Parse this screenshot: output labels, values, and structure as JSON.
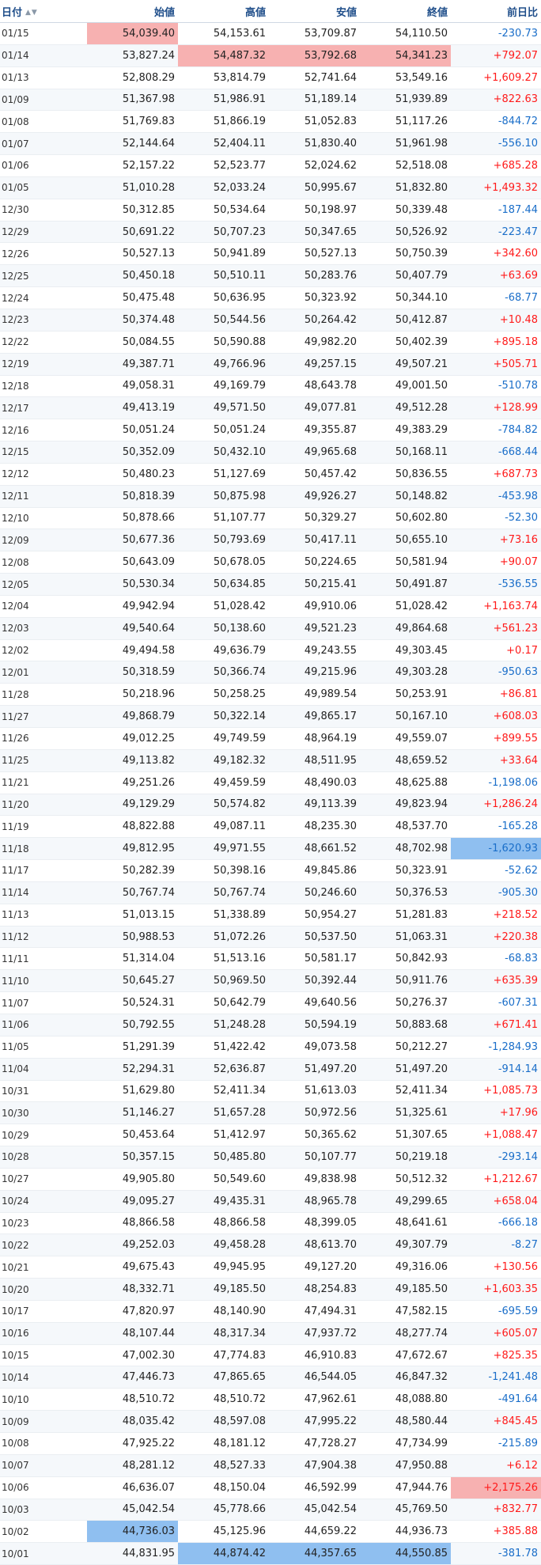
{
  "table": {
    "headers": {
      "date": "日付",
      "open": "始値",
      "high": "高値",
      "low": "安値",
      "close": "終値",
      "change": "前日比"
    },
    "sort_icon": "sort-arrows-icon",
    "colors": {
      "positive": "#ff1a1a",
      "negative": "#1a6ec9",
      "highlight_red": "#f7b1b1",
      "highlight_blue": "#8fbff0"
    },
    "rows": [
      {
        "date": "01/15",
        "open": "54,039.40",
        "high": "54,153.61",
        "low": "53,709.87",
        "close": "54,110.50",
        "change": "-230.73",
        "hl": {
          "open": "red"
        }
      },
      {
        "date": "01/14",
        "open": "53,827.24",
        "high": "54,487.32",
        "low": "53,792.68",
        "close": "54,341.23",
        "change": "+792.07",
        "hl": {
          "high": "red",
          "low": "red",
          "close": "red"
        }
      },
      {
        "date": "01/13",
        "open": "52,808.29",
        "high": "53,814.79",
        "low": "52,741.64",
        "close": "53,549.16",
        "change": "+1,609.27"
      },
      {
        "date": "01/09",
        "open": "51,367.98",
        "high": "51,986.91",
        "low": "51,189.14",
        "close": "51,939.89",
        "change": "+822.63"
      },
      {
        "date": "01/08",
        "open": "51,769.83",
        "high": "51,866.19",
        "low": "51,052.83",
        "close": "51,117.26",
        "change": "-844.72"
      },
      {
        "date": "01/07",
        "open": "52,144.64",
        "high": "52,404.11",
        "low": "51,830.40",
        "close": "51,961.98",
        "change": "-556.10"
      },
      {
        "date": "01/06",
        "open": "52,157.22",
        "high": "52,523.77",
        "low": "52,024.62",
        "close": "52,518.08",
        "change": "+685.28"
      },
      {
        "date": "01/05",
        "open": "51,010.28",
        "high": "52,033.24",
        "low": "50,995.67",
        "close": "51,832.80",
        "change": "+1,493.32"
      },
      {
        "date": "12/30",
        "open": "50,312.85",
        "high": "50,534.64",
        "low": "50,198.97",
        "close": "50,339.48",
        "change": "-187.44"
      },
      {
        "date": "12/29",
        "open": "50,691.22",
        "high": "50,707.23",
        "low": "50,347.65",
        "close": "50,526.92",
        "change": "-223.47"
      },
      {
        "date": "12/26",
        "open": "50,527.13",
        "high": "50,941.89",
        "low": "50,527.13",
        "close": "50,750.39",
        "change": "+342.60"
      },
      {
        "date": "12/25",
        "open": "50,450.18",
        "high": "50,510.11",
        "low": "50,283.76",
        "close": "50,407.79",
        "change": "+63.69"
      },
      {
        "date": "12/24",
        "open": "50,475.48",
        "high": "50,636.95",
        "low": "50,323.92",
        "close": "50,344.10",
        "change": "-68.77"
      },
      {
        "date": "12/23",
        "open": "50,374.48",
        "high": "50,544.56",
        "low": "50,264.42",
        "close": "50,412.87",
        "change": "+10.48"
      },
      {
        "date": "12/22",
        "open": "50,084.55",
        "high": "50,590.88",
        "low": "49,982.20",
        "close": "50,402.39",
        "change": "+895.18"
      },
      {
        "date": "12/19",
        "open": "49,387.71",
        "high": "49,766.96",
        "low": "49,257.15",
        "close": "49,507.21",
        "change": "+505.71"
      },
      {
        "date": "12/18",
        "open": "49,058.31",
        "high": "49,169.79",
        "low": "48,643.78",
        "close": "49,001.50",
        "change": "-510.78"
      },
      {
        "date": "12/17",
        "open": "49,413.19",
        "high": "49,571.50",
        "low": "49,077.81",
        "close": "49,512.28",
        "change": "+128.99"
      },
      {
        "date": "12/16",
        "open": "50,051.24",
        "high": "50,051.24",
        "low": "49,355.87",
        "close": "49,383.29",
        "change": "-784.82"
      },
      {
        "date": "12/15",
        "open": "50,352.09",
        "high": "50,432.10",
        "low": "49,965.68",
        "close": "50,168.11",
        "change": "-668.44"
      },
      {
        "date": "12/12",
        "open": "50,480.23",
        "high": "51,127.69",
        "low": "50,457.42",
        "close": "50,836.55",
        "change": "+687.73"
      },
      {
        "date": "12/11",
        "open": "50,818.39",
        "high": "50,875.98",
        "low": "49,926.27",
        "close": "50,148.82",
        "change": "-453.98"
      },
      {
        "date": "12/10",
        "open": "50,878.66",
        "high": "51,107.77",
        "low": "50,329.27",
        "close": "50,602.80",
        "change": "-52.30"
      },
      {
        "date": "12/09",
        "open": "50,677.36",
        "high": "50,793.69",
        "low": "50,417.11",
        "close": "50,655.10",
        "change": "+73.16"
      },
      {
        "date": "12/08",
        "open": "50,643.09",
        "high": "50,678.05",
        "low": "50,224.65",
        "close": "50,581.94",
        "change": "+90.07"
      },
      {
        "date": "12/05",
        "open": "50,530.34",
        "high": "50,634.85",
        "low": "50,215.41",
        "close": "50,491.87",
        "change": "-536.55"
      },
      {
        "date": "12/04",
        "open": "49,942.94",
        "high": "51,028.42",
        "low": "49,910.06",
        "close": "51,028.42",
        "change": "+1,163.74"
      },
      {
        "date": "12/03",
        "open": "49,540.64",
        "high": "50,138.60",
        "low": "49,521.23",
        "close": "49,864.68",
        "change": "+561.23"
      },
      {
        "date": "12/02",
        "open": "49,494.58",
        "high": "49,636.79",
        "low": "49,243.55",
        "close": "49,303.45",
        "change": "+0.17"
      },
      {
        "date": "12/01",
        "open": "50,318.59",
        "high": "50,366.74",
        "low": "49,215.96",
        "close": "49,303.28",
        "change": "-950.63"
      },
      {
        "date": "11/28",
        "open": "50,218.96",
        "high": "50,258.25",
        "low": "49,989.54",
        "close": "50,253.91",
        "change": "+86.81"
      },
      {
        "date": "11/27",
        "open": "49,868.79",
        "high": "50,322.14",
        "low": "49,865.17",
        "close": "50,167.10",
        "change": "+608.03"
      },
      {
        "date": "11/26",
        "open": "49,012.25",
        "high": "49,749.59",
        "low": "48,964.19",
        "close": "49,559.07",
        "change": "+899.55"
      },
      {
        "date": "11/25",
        "open": "49,113.82",
        "high": "49,182.32",
        "low": "48,511.95",
        "close": "48,659.52",
        "change": "+33.64"
      },
      {
        "date": "11/21",
        "open": "49,251.26",
        "high": "49,459.59",
        "low": "48,490.03",
        "close": "48,625.88",
        "change": "-1,198.06"
      },
      {
        "date": "11/20",
        "open": "49,129.29",
        "high": "50,574.82",
        "low": "49,113.39",
        "close": "49,823.94",
        "change": "+1,286.24"
      },
      {
        "date": "11/19",
        "open": "48,822.88",
        "high": "49,087.11",
        "low": "48,235.30",
        "close": "48,537.70",
        "change": "-165.28"
      },
      {
        "date": "11/18",
        "open": "49,812.95",
        "high": "49,971.55",
        "low": "48,661.52",
        "close": "48,702.98",
        "change": "-1,620.93",
        "hl": {
          "change": "blue"
        }
      },
      {
        "date": "11/17",
        "open": "50,282.39",
        "high": "50,398.16",
        "low": "49,845.86",
        "close": "50,323.91",
        "change": "-52.62"
      },
      {
        "date": "11/14",
        "open": "50,767.74",
        "high": "50,767.74",
        "low": "50,246.60",
        "close": "50,376.53",
        "change": "-905.30"
      },
      {
        "date": "11/13",
        "open": "51,013.15",
        "high": "51,338.89",
        "low": "50,954.27",
        "close": "51,281.83",
        "change": "+218.52"
      },
      {
        "date": "11/12",
        "open": "50,988.53",
        "high": "51,072.26",
        "low": "50,537.50",
        "close": "51,063.31",
        "change": "+220.38"
      },
      {
        "date": "11/11",
        "open": "51,314.04",
        "high": "51,513.16",
        "low": "50,581.17",
        "close": "50,842.93",
        "change": "-68.83"
      },
      {
        "date": "11/10",
        "open": "50,645.27",
        "high": "50,969.50",
        "low": "50,392.44",
        "close": "50,911.76",
        "change": "+635.39"
      },
      {
        "date": "11/07",
        "open": "50,524.31",
        "high": "50,642.79",
        "low": "49,640.56",
        "close": "50,276.37",
        "change": "-607.31"
      },
      {
        "date": "11/06",
        "open": "50,792.55",
        "high": "51,248.28",
        "low": "50,594.19",
        "close": "50,883.68",
        "change": "+671.41"
      },
      {
        "date": "11/05",
        "open": "51,291.39",
        "high": "51,422.42",
        "low": "49,073.58",
        "close": "50,212.27",
        "change": "-1,284.93"
      },
      {
        "date": "11/04",
        "open": "52,294.31",
        "high": "52,636.87",
        "low": "51,497.20",
        "close": "51,497.20",
        "change": "-914.14"
      },
      {
        "date": "10/31",
        "open": "51,629.80",
        "high": "52,411.34",
        "low": "51,613.03",
        "close": "52,411.34",
        "change": "+1,085.73"
      },
      {
        "date": "10/30",
        "open": "51,146.27",
        "high": "51,657.28",
        "low": "50,972.56",
        "close": "51,325.61",
        "change": "+17.96"
      },
      {
        "date": "10/29",
        "open": "50,453.64",
        "high": "51,412.97",
        "low": "50,365.62",
        "close": "51,307.65",
        "change": "+1,088.47"
      },
      {
        "date": "10/28",
        "open": "50,357.15",
        "high": "50,485.80",
        "low": "50,107.77",
        "close": "50,219.18",
        "change": "-293.14"
      },
      {
        "date": "10/27",
        "open": "49,905.80",
        "high": "50,549.60",
        "low": "49,838.98",
        "close": "50,512.32",
        "change": "+1,212.67"
      },
      {
        "date": "10/24",
        "open": "49,095.27",
        "high": "49,435.31",
        "low": "48,965.78",
        "close": "49,299.65",
        "change": "+658.04"
      },
      {
        "date": "10/23",
        "open": "48,866.58",
        "high": "48,866.58",
        "low": "48,399.05",
        "close": "48,641.61",
        "change": "-666.18"
      },
      {
        "date": "10/22",
        "open": "49,252.03",
        "high": "49,458.28",
        "low": "48,613.70",
        "close": "49,307.79",
        "change": "-8.27"
      },
      {
        "date": "10/21",
        "open": "49,675.43",
        "high": "49,945.95",
        "low": "49,127.20",
        "close": "49,316.06",
        "change": "+130.56"
      },
      {
        "date": "10/20",
        "open": "48,332.71",
        "high": "49,185.50",
        "low": "48,254.83",
        "close": "49,185.50",
        "change": "+1,603.35"
      },
      {
        "date": "10/17",
        "open": "47,820.97",
        "high": "48,140.90",
        "low": "47,494.31",
        "close": "47,582.15",
        "change": "-695.59"
      },
      {
        "date": "10/16",
        "open": "48,107.44",
        "high": "48,317.34",
        "low": "47,937.72",
        "close": "48,277.74",
        "change": "+605.07"
      },
      {
        "date": "10/15",
        "open": "47,002.30",
        "high": "47,774.83",
        "low": "46,910.83",
        "close": "47,672.67",
        "change": "+825.35"
      },
      {
        "date": "10/14",
        "open": "47,446.73",
        "high": "47,865.65",
        "low": "46,544.05",
        "close": "46,847.32",
        "change": "-1,241.48"
      },
      {
        "date": "10/10",
        "open": "48,510.72",
        "high": "48,510.72",
        "low": "47,962.61",
        "close": "48,088.80",
        "change": "-491.64"
      },
      {
        "date": "10/09",
        "open": "48,035.42",
        "high": "48,597.08",
        "low": "47,995.22",
        "close": "48,580.44",
        "change": "+845.45"
      },
      {
        "date": "10/08",
        "open": "47,925.22",
        "high": "48,181.12",
        "low": "47,728.27",
        "close": "47,734.99",
        "change": "-215.89"
      },
      {
        "date": "10/07",
        "open": "48,281.12",
        "high": "48,527.33",
        "low": "47,904.38",
        "close": "47,950.88",
        "change": "+6.12"
      },
      {
        "date": "10/06",
        "open": "46,636.07",
        "high": "48,150.04",
        "low": "46,592.99",
        "close": "47,944.76",
        "change": "+2,175.26",
        "hl": {
          "change": "red"
        }
      },
      {
        "date": "10/03",
        "open": "45,042.54",
        "high": "45,778.66",
        "low": "45,042.54",
        "close": "45,769.50",
        "change": "+832.77"
      },
      {
        "date": "10/02",
        "open": "44,736.03",
        "high": "45,125.96",
        "low": "44,659.22",
        "close": "44,936.73",
        "change": "+385.88",
        "hl": {
          "open": "blue"
        }
      },
      {
        "date": "10/01",
        "open": "44,831.95",
        "high": "44,874.42",
        "low": "44,357.65",
        "close": "44,550.85",
        "change": "-381.78",
        "hl": {
          "high": "blue",
          "low": "blue",
          "close": "blue"
        }
      }
    ]
  }
}
